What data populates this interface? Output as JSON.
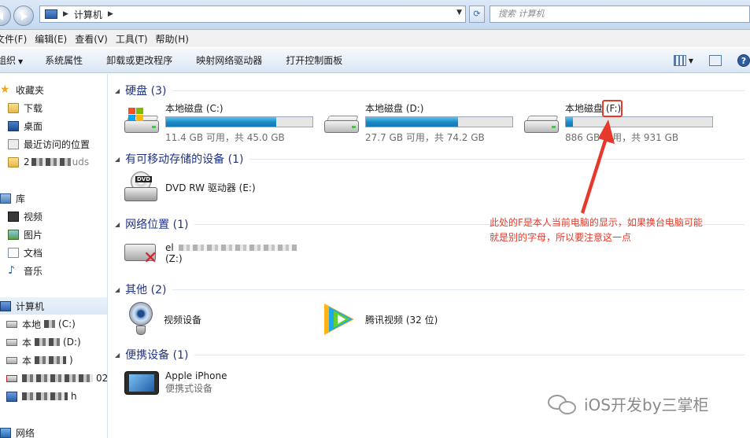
{
  "address_bar": {
    "path": "计算机",
    "search_placeholder": "搜索 计算机"
  },
  "menu": [
    "文件(F)",
    "编辑(E)",
    "查看(V)",
    "工具(T)",
    "帮助(H)"
  ],
  "commands": {
    "organize": "组织",
    "system_properties": "系统属性",
    "uninstall": "卸载或更改程序",
    "map_drive": "映射网络驱动器",
    "control_panel": "打开控制面板"
  },
  "sidebar": {
    "favorites": "收藏夹",
    "downloads": "下载",
    "desktop": "桌面",
    "recent": "最近访问的位置",
    "blurred_item": "2",
    "blurred_item_tail": "uds",
    "libraries": "库",
    "videos": "视频",
    "pictures": "图片",
    "documents": "文档",
    "music": "音乐",
    "computer": "计算机",
    "drive_c_prefix": "本地",
    "drive_c_suffix": "(C:)",
    "drive_d_prefix": "本",
    "drive_d_suffix": "(D:)",
    "drive_f_prefix": "本",
    "drive_f_suffix": ")",
    "row4_tail": "02",
    "row5_tail": "h",
    "network": "网络"
  },
  "groups": {
    "hard_disks": "硬盘 (3)",
    "removable": "有可移动存储的设备 (1)",
    "network_locations": "网络位置 (1)",
    "other": "其他 (2)",
    "portable": "便携设备 (1)"
  },
  "drives": [
    {
      "name": "本地磁盘 (C:)",
      "free": "11.4 GB 可用，共 45.0 GB",
      "used_fraction": 0.75
    },
    {
      "name": "本地磁盘 (D:)",
      "free": "27.7 GB 可用，共 74.2 GB",
      "used_fraction": 0.63
    },
    {
      "name": "本地磁盘 (F:)",
      "free": "886 GB 可用，共 931 GB",
      "used_fraction": 0.05
    }
  ],
  "dvd": {
    "name": "DVD RW 驱动器 (E:)",
    "disc_label": "DVD"
  },
  "net_drive": {
    "name": "el",
    "letter": "(Z:)"
  },
  "other_items": {
    "camera": "视频设备",
    "tencent": "腾讯视频 (32 位)"
  },
  "portable_device": {
    "name": "Apple iPhone",
    "subtitle": "便携式设备"
  },
  "annotation": {
    "line1": "此处的F是本人当前电脑的显示，如果换台电脑可能",
    "line2": "就是别的字母，所以要注意这一点"
  },
  "watermark": "iOS开发by三掌柜",
  "colors": {
    "accent": "#1e3287",
    "annotation": "#e53a2b",
    "usage_bar": "#1a86c4"
  }
}
